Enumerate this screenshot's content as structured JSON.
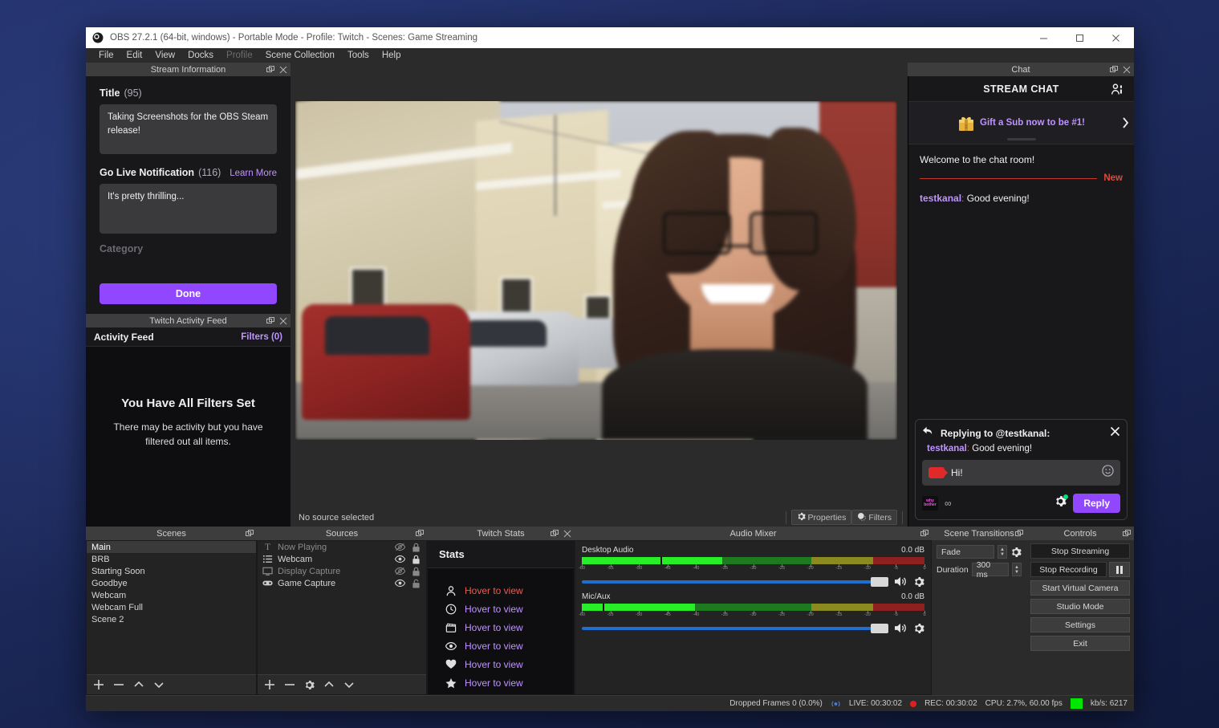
{
  "window": {
    "title": "OBS 27.2.1 (64-bit, windows) - Portable Mode - Profile: Twitch - Scenes: Game Streaming",
    "logo_icon": "obs-logo-icon",
    "minimize_label": "—",
    "maximize_label": "□",
    "close_label": "✕"
  },
  "menubar": {
    "items": [
      {
        "label": "File",
        "disabled": false
      },
      {
        "label": "Edit",
        "disabled": false
      },
      {
        "label": "View",
        "disabled": false
      },
      {
        "label": "Docks",
        "disabled": false
      },
      {
        "label": "Profile",
        "disabled": true
      },
      {
        "label": "Scene Collection",
        "disabled": false
      },
      {
        "label": "Tools",
        "disabled": false
      },
      {
        "label": "Help",
        "disabled": false
      }
    ]
  },
  "stream_information": {
    "dock_title": "Stream Information",
    "title_label": "Title",
    "title_count": "(95)",
    "title_value": "Taking Screenshots for the OBS Steam release!",
    "notification_label": "Go Live Notification",
    "notification_count": "(116)",
    "learn_more_label": "Learn More",
    "notification_value": "It's pretty thrilling...",
    "category_label": "Category",
    "done_label": "Done"
  },
  "activity_feed": {
    "dock_title": "Twitch Activity Feed",
    "header_label": "Activity Feed",
    "filters_label": "Filters (0)",
    "empty_title": "You Have All Filters Set",
    "empty_body": "There may be activity but you have filtered out all items."
  },
  "preview": {
    "status_text": "No source selected",
    "properties_label": "Properties",
    "filters_label": "Filters",
    "properties_icon": "gear-icon",
    "filters_icon": "filters-icon"
  },
  "chat": {
    "dock_title": "Chat",
    "header_label": "STREAM CHAT",
    "users_icon": "users-icon",
    "promo": {
      "text": "Gift a Sub now to be #1!",
      "gift_icon": "gift-box-icon",
      "prev_icon": "chevron-left-icon",
      "next_icon": "chevron-right-icon"
    },
    "messages": [
      {
        "type": "system",
        "text": "Welcome to the chat room!"
      }
    ],
    "new_divider_label": "New",
    "user_message": {
      "user": "testkanal",
      "separator": ": ",
      "text": "Good evening!"
    },
    "composer": {
      "replying_label": "Replying to @testkanal:",
      "reply_icon": "reply-arrow-icon",
      "close_icon": "close-icon",
      "quote_user": "testkanal",
      "quote_separator": ": ",
      "quote_text": "Good evening!",
      "input_value": "Hi!",
      "camera_icon": "camera-icon",
      "emoji_icon": "smiley-icon",
      "badge_icon": "emote-badge-icon",
      "badge_text": "why bother",
      "infinity_label": "∞",
      "settings_icon": "gear-icon",
      "reply_button_label": "Reply"
    }
  },
  "scenes": {
    "dock_title": "Scenes",
    "items": [
      {
        "label": "Main",
        "selected": true
      },
      {
        "label": "BRB",
        "selected": false
      },
      {
        "label": "Starting Soon",
        "selected": false
      },
      {
        "label": "Goodbye",
        "selected": false
      },
      {
        "label": "Webcam",
        "selected": false
      },
      {
        "label": "Webcam Full",
        "selected": false
      },
      {
        "label": "Scene 2",
        "selected": false
      }
    ],
    "toolbar": [
      {
        "name": "add-scene-button",
        "glyph": "+"
      },
      {
        "name": "remove-scene-button",
        "glyph": "−"
      },
      {
        "name": "move-scene-up-button",
        "glyph": "∧"
      },
      {
        "name": "move-scene-down-button",
        "glyph": "∨"
      }
    ]
  },
  "sources": {
    "dock_title": "Sources",
    "items": [
      {
        "label": "Now Playing",
        "icon": "text-source-icon",
        "visible": false,
        "locked": true
      },
      {
        "label": "Webcam",
        "icon": "list-source-icon",
        "visible": true,
        "locked": true
      },
      {
        "label": "Display Capture",
        "icon": "monitor-icon",
        "visible": false,
        "locked": true
      },
      {
        "label": "Game Capture",
        "icon": "gamepad-icon",
        "visible": true,
        "locked": false
      }
    ],
    "toolbar": [
      {
        "name": "add-source-button",
        "glyph": "+"
      },
      {
        "name": "remove-source-button",
        "glyph": "−"
      },
      {
        "name": "source-properties-button",
        "glyph": "gear-icon"
      },
      {
        "name": "move-source-up-button",
        "glyph": "∧"
      },
      {
        "name": "move-source-down-button",
        "glyph": "∨"
      }
    ]
  },
  "twitch_stats": {
    "dock_title": "Twitch Stats",
    "header_label": "Stats",
    "rows": [
      {
        "icon": "person-icon",
        "label": "Hover to view",
        "highlight": true
      },
      {
        "icon": "clock-icon",
        "label": "Hover to view",
        "highlight": false
      },
      {
        "icon": "clapperboard-icon",
        "label": "Hover to view",
        "highlight": false
      },
      {
        "icon": "eye-icon",
        "label": "Hover to view",
        "highlight": false
      },
      {
        "icon": "heart-icon",
        "label": "Hover to view",
        "highlight": false
      },
      {
        "icon": "star-icon",
        "label": "Hover to view",
        "highlight": false
      }
    ]
  },
  "audio_mixer": {
    "dock_title": "Audio Mixer",
    "tick_labels": [
      "-60",
      "-55",
      "-50",
      "-45",
      "-40",
      "-35",
      "-30",
      "-25",
      "-20",
      "-15",
      "-10",
      "-5",
      "0"
    ],
    "channels": [
      {
        "name": "Desktop Audio",
        "db": "0.0 dB",
        "level_pct": 41,
        "peak_pct": 23,
        "volume_pct": 100,
        "mute_icon": "speaker-icon",
        "settings_icon": "gear-icon"
      },
      {
        "name": "Mic/Aux",
        "db": "0.0 dB",
        "level_pct": 33,
        "peak_pct": 6,
        "volume_pct": 100,
        "mute_icon": "speaker-icon",
        "settings_icon": "gear-icon"
      }
    ]
  },
  "scene_transitions": {
    "dock_title": "Scene Transitions",
    "transition_value": "Fade",
    "settings_icon": "gear-icon",
    "duration_label": "Duration",
    "duration_value": "300 ms"
  },
  "controls": {
    "dock_title": "Controls",
    "buttons": [
      {
        "label": "Stop Streaming",
        "style": "dark",
        "has_pause": false
      },
      {
        "label": "Stop Recording",
        "style": "dark",
        "has_pause": true
      },
      {
        "label": "Start Virtual Camera",
        "style": "normal",
        "has_pause": false
      },
      {
        "label": "Studio Mode",
        "style": "normal",
        "has_pause": false
      },
      {
        "label": "Settings",
        "style": "normal",
        "has_pause": false
      },
      {
        "label": "Exit",
        "style": "normal",
        "has_pause": false
      }
    ],
    "pause_icon": "pause-icon"
  },
  "statusbar": {
    "dropped_frames": "Dropped Frames 0 (0.0%)",
    "live_icon": "live-broadcast-icon",
    "live_time": "LIVE: 00:30:02",
    "rec_icon": "record-dot-icon",
    "rec_time": "REC: 00:30:02",
    "cpu": "CPU: 2.7%, 60.00 fps",
    "kbps": "kb/s: 6217"
  },
  "colors": {
    "twitch_purple": "#9147ff",
    "twitch_link": "#bf94ff",
    "obs_dark": "#2b2b2b",
    "chat_bg": "#18181b",
    "status_green": "#00e800",
    "rec_red": "#e02020"
  }
}
